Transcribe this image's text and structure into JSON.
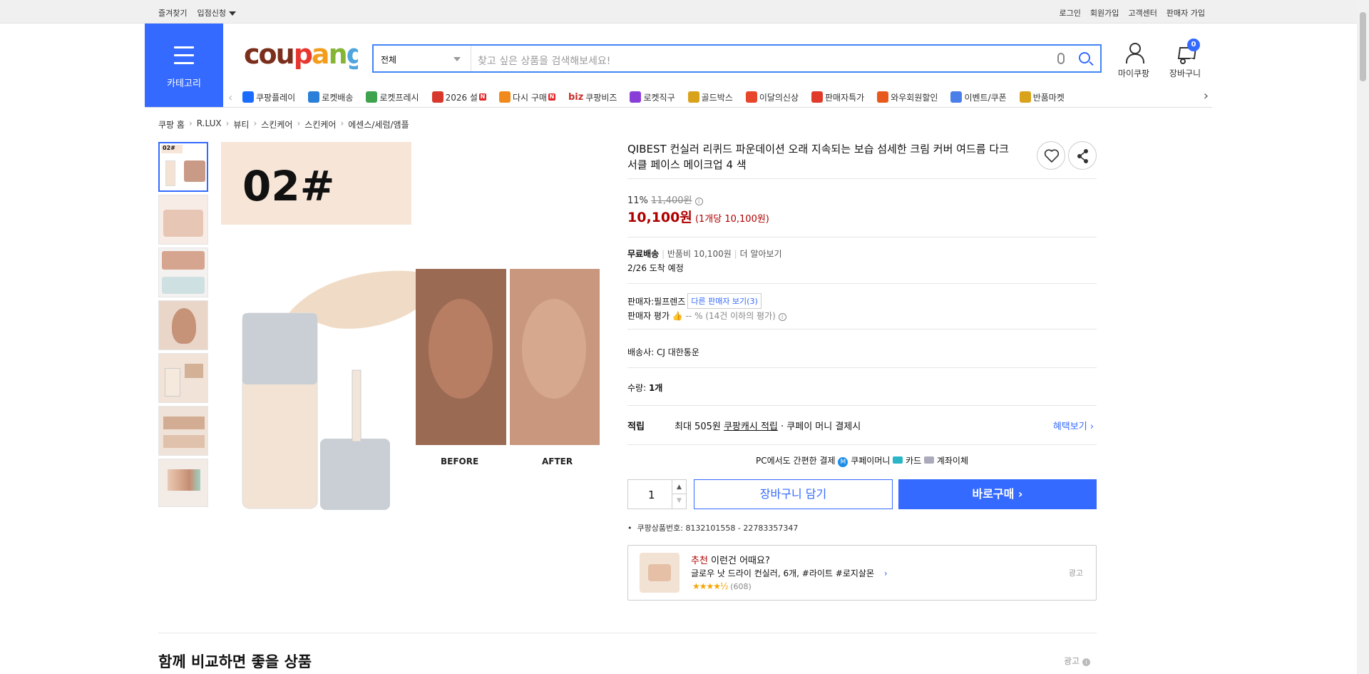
{
  "topbar": {
    "left": [
      "즐겨찾기",
      "입점신청"
    ],
    "right": [
      "로그인",
      "회원가입",
      "고객센터",
      "판매자 가입"
    ]
  },
  "header": {
    "category_label": "카테고리",
    "logo": "coupang",
    "search": {
      "scope": "전체",
      "placeholder": "찾고 싶은 상품을 검색해보세요!"
    },
    "my_coupang": "마이쿠팡",
    "cart": "장바구니",
    "cart_count": "0"
  },
  "nav": {
    "items": [
      {
        "label": "쿠팡플레이",
        "icon": "play-icon",
        "color": "#1a6cff",
        "new": false
      },
      {
        "label": "로켓배송",
        "icon": "rocket-icon",
        "color": "#2a7fd8",
        "new": false
      },
      {
        "label": "로켓프레시",
        "icon": "rocket-fresh-icon",
        "color": "#3fa34d",
        "new": false
      },
      {
        "label": "2026 설",
        "icon": "gift-icon",
        "color": "#d8382c",
        "new": true
      },
      {
        "label": "다시 구매",
        "icon": "home-icon",
        "color": "#f08a1c",
        "new": true
      },
      {
        "label": "쿠팡비즈",
        "icon": "biz-icon",
        "color": "#111111",
        "new": false,
        "prefix": "biz"
      },
      {
        "label": "로켓직구",
        "icon": "globe-icon",
        "color": "#8a3ed8",
        "new": false
      },
      {
        "label": "골드박스",
        "icon": "goldbox-icon",
        "color": "#d9a21b",
        "new": false
      },
      {
        "label": "이달의신상",
        "icon": "bag-icon",
        "color": "#e8462b",
        "new": false
      },
      {
        "label": "판매자특가",
        "icon": "percent-icon",
        "color": "#e03a2a",
        "new": false
      },
      {
        "label": "와우회원할인",
        "icon": "wow-icon",
        "color": "#e85a1b",
        "new": false
      },
      {
        "label": "이벤트/쿠폰",
        "icon": "coupon-icon",
        "color": "#4a7ee8",
        "new": false
      },
      {
        "label": "반품마켓",
        "icon": "market-icon",
        "color": "#d9a21b",
        "new": false
      }
    ]
  },
  "breadcrumb": [
    "쿠팡 홈",
    "R.LUX",
    "뷰티",
    "스킨케어",
    "스킨케어",
    "에센스/세럼/앰플"
  ],
  "product": {
    "image_text": "02#",
    "before": "BEFORE",
    "after": "AFTER",
    "title": "QIBEST 컨실러 리퀴드 파운데이션 오래 지속되는 보습 섬세한 크림 커버 여드름 다크 서클 페이스 메이크업 4 색",
    "discount": "11%",
    "original_price": "11,400원",
    "price": "10,100원",
    "unit_price": "(1개당 10,100원)",
    "shipping": "무료배송",
    "return_fee": "반품비 10,100원",
    "learn_more": "더 알아보기",
    "arrival": "2/26 도착 예정",
    "seller_label": "판매자:",
    "seller": "필프렌즈",
    "other_sellers": "다른 판매자 보기(3)",
    "seller_rating_label": "판매자 평가",
    "seller_rating": "-- % (14건 이하의 평가)",
    "carrier": "배송사:  CJ 대한통운",
    "quantity_label": "수량: ",
    "quantity_value": "1개",
    "points_label": "적립",
    "points_text": "최대 505원",
    "points_link": "쿠팡캐시 적립",
    "points_tail": "· 쿠페이 머니 결제시",
    "benefits": "혜택보기",
    "pc_pay": "PC에서도 간편한 결제",
    "pay_methods": [
      "쿠페이머니",
      "카드",
      "계좌이체"
    ],
    "qty_input": "1",
    "add_to_cart": "장바구니 담기",
    "buy_now": "바로구매",
    "product_no_label": "쿠팡상품번호: ",
    "product_no": "8132101558 - 22783357347",
    "reco_title_red": "추천",
    "reco_title": " 이런건 어때요?",
    "reco_item": "글로우 낫 드라이 컨실러, 6개, #라이트 #로지살몬",
    "reco_stars": "★★★★½",
    "reco_reviews": "(608)",
    "ad_label": "광고"
  },
  "section": {
    "title": "함께 비교하면 좋을 상품",
    "ad_label": "광고"
  },
  "colors": {
    "accent": "#346aff",
    "price": "#ae0000"
  }
}
